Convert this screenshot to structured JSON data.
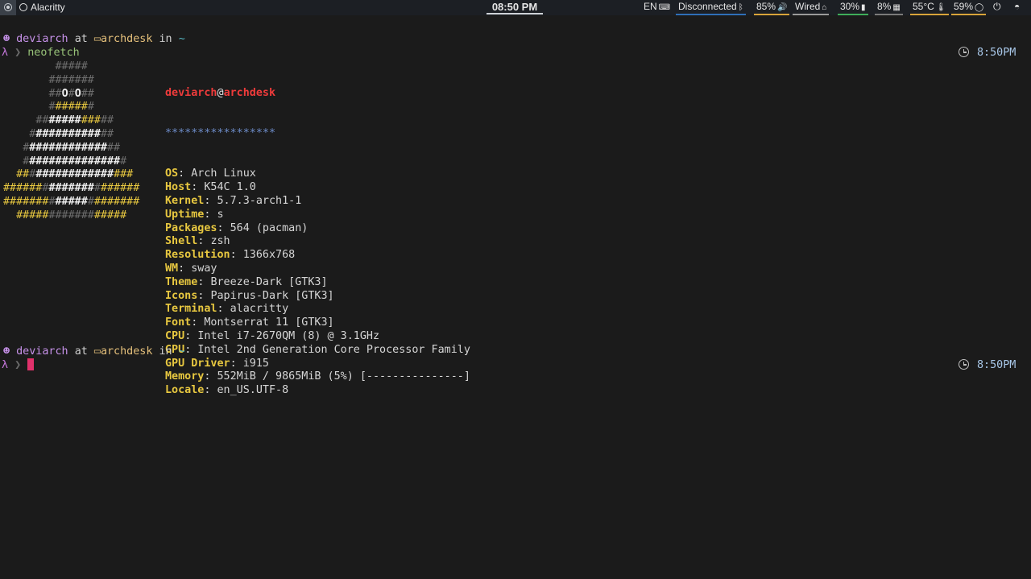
{
  "bar": {
    "window_title": "Alacritty",
    "clock": "08:50 PM",
    "modules": [
      {
        "id": "lang",
        "text": "EN",
        "icon": "keyboard-icon",
        "underline": ""
      },
      {
        "id": "bluetooth",
        "text": "Disconnected",
        "icon": "bluetooth-icon",
        "underline": "#2f6fb8"
      },
      {
        "id": "volume",
        "text": "85%",
        "icon": "volume-icon",
        "underline": "#d8a43a"
      },
      {
        "id": "network",
        "text": "Wired",
        "icon": "wired-icon",
        "underline": "#9a9a9a"
      },
      {
        "id": "battery",
        "text": "30%",
        "icon": "battery-icon",
        "underline": "#3fae5a"
      },
      {
        "id": "memory",
        "text": "8%",
        "icon": "memory-icon",
        "underline": "#7a7a7a"
      },
      {
        "id": "temperature",
        "text": "55°C",
        "icon": "thermometer-icon",
        "underline": "#d8a43a"
      },
      {
        "id": "cpu",
        "text": "59%",
        "icon": "cpu-circle-icon",
        "underline": "#d8a43a"
      }
    ],
    "power_icon": "power-icon",
    "menu_icon": "menu-icon"
  },
  "prompt1": {
    "user": "deviarch",
    "at": "at",
    "host": "archdesk",
    "in": "in",
    "path": "~",
    "lambda": "λ",
    "arrow": "❯",
    "command": "neofetch",
    "time": "8:50PM"
  },
  "prompt2": {
    "user": "deviarch",
    "at": "at",
    "host": "archdesk",
    "in": "in",
    "path": "~",
    "lambda": "λ",
    "arrow": "❯",
    "command": "",
    "time": "8:50PM"
  },
  "neofetch": {
    "user": "deviarch",
    "at": "@",
    "host": "archdesk",
    "separator": "*****************",
    "fields": [
      {
        "key": "OS",
        "value": "Arch Linux"
      },
      {
        "key": "Host",
        "value": "K54C 1.0"
      },
      {
        "key": "Kernel",
        "value": "5.7.3-arch1-1"
      },
      {
        "key": "Uptime",
        "value": "s"
      },
      {
        "key": "Packages",
        "value": "564 (pacman)"
      },
      {
        "key": "Shell",
        "value": "zsh"
      },
      {
        "key": "Resolution",
        "value": "1366x768"
      },
      {
        "key": "WM",
        "value": "sway"
      },
      {
        "key": "Theme",
        "value": "Breeze-Dark [GTK3]"
      },
      {
        "key": "Icons",
        "value": "Papirus-Dark [GTK3]"
      },
      {
        "key": "Terminal",
        "value": "alacritty"
      },
      {
        "key": "Font",
        "value": "Montserrat 11 [GTK3]"
      },
      {
        "key": "CPU",
        "value": "Intel i7-2670QM (8) @ 3.1GHz"
      },
      {
        "key": "GPU",
        "value": "Intel 2nd Generation Core Processor Family"
      },
      {
        "key": "GPU Driver",
        "value": "i915"
      },
      {
        "key": "Memory",
        "value": "552MiB / 9865MiB (5%) [---------------]"
      },
      {
        "key": "Locale",
        "value": "en_US.UTF-8"
      }
    ]
  },
  "ascii_art": [
    "        #####",
    "       #######",
    "       ##O#O##",
    "       #######",
    "     ###########",
    "    #############",
    "   ###############",
    "   ################",
    "  #################",
    "#####################",
    "#####################",
    "  #################"
  ]
}
